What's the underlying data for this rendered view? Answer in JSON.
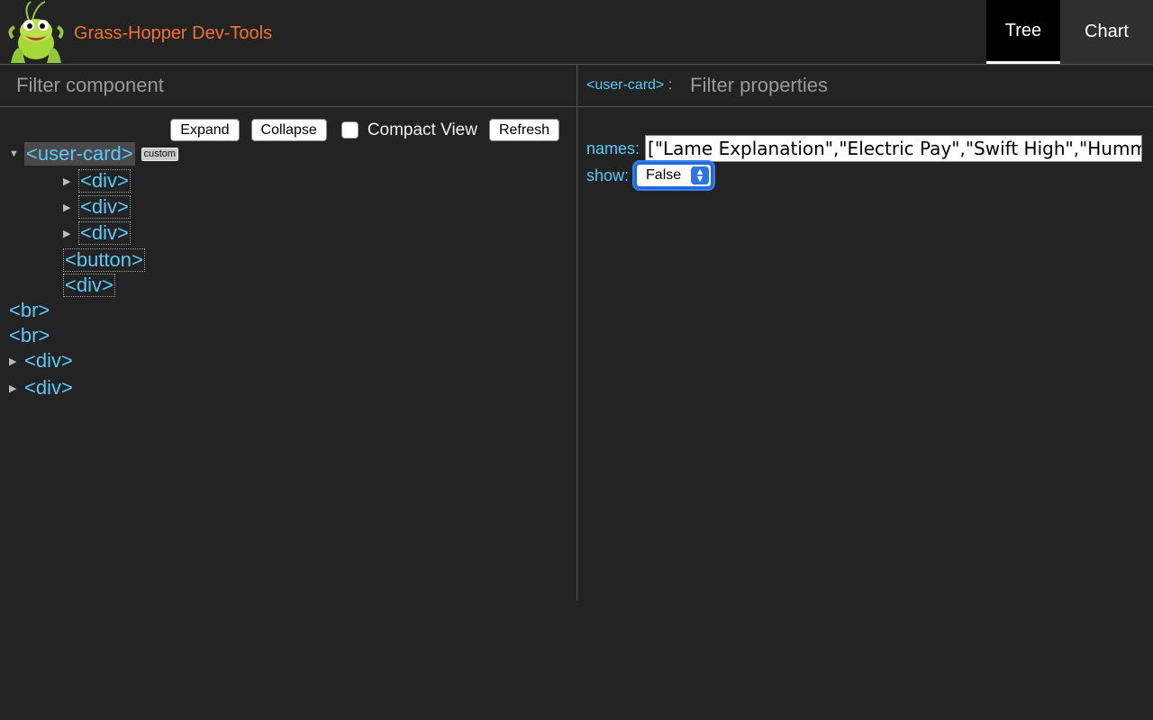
{
  "header": {
    "app_title": "Grass-Hopper Dev-Tools",
    "logo_icon": "grasshopper-logo-icon",
    "tabs": [
      {
        "label": "Tree",
        "active": true
      },
      {
        "label": "Chart",
        "active": false
      }
    ]
  },
  "left_panel": {
    "filter_placeholder": "Filter component",
    "filter_value": "",
    "toolbar": {
      "expand_label": "Expand",
      "collapse_label": "Collapse",
      "compact_view_label": "Compact View",
      "compact_view_checked": false,
      "refresh_label": "Refresh"
    },
    "tree": [
      {
        "label": "<user-card>",
        "badge": "custom",
        "expanded": true,
        "selected": true
      },
      {
        "label": "<div>",
        "collapsed_arrow": true
      },
      {
        "label": "<div>",
        "collapsed_arrow": true
      },
      {
        "label": "<div>",
        "collapsed_arrow": true
      },
      {
        "label": "<button>"
      },
      {
        "label": "<div>"
      },
      {
        "label": "<br>"
      },
      {
        "label": "<br>"
      },
      {
        "label": "<div>",
        "collapsed_arrow": true
      },
      {
        "label": "<div>",
        "collapsed_arrow": true
      }
    ]
  },
  "right_panel": {
    "component_prefix": "<user-card> :",
    "filter_placeholder": "Filter properties",
    "filter_value": "",
    "properties": {
      "names_label": "names:",
      "names_value": "[\"Lame Explanation\",\"Electric Pay\",\"Swift High\",\"Humming Car",
      "show_label": "show:",
      "show_value": "False"
    }
  },
  "colors": {
    "background": "#232323",
    "title_accent": "#f0722c",
    "tag_blue": "#5ac8fa",
    "select_focus": "#1f6bd9"
  }
}
